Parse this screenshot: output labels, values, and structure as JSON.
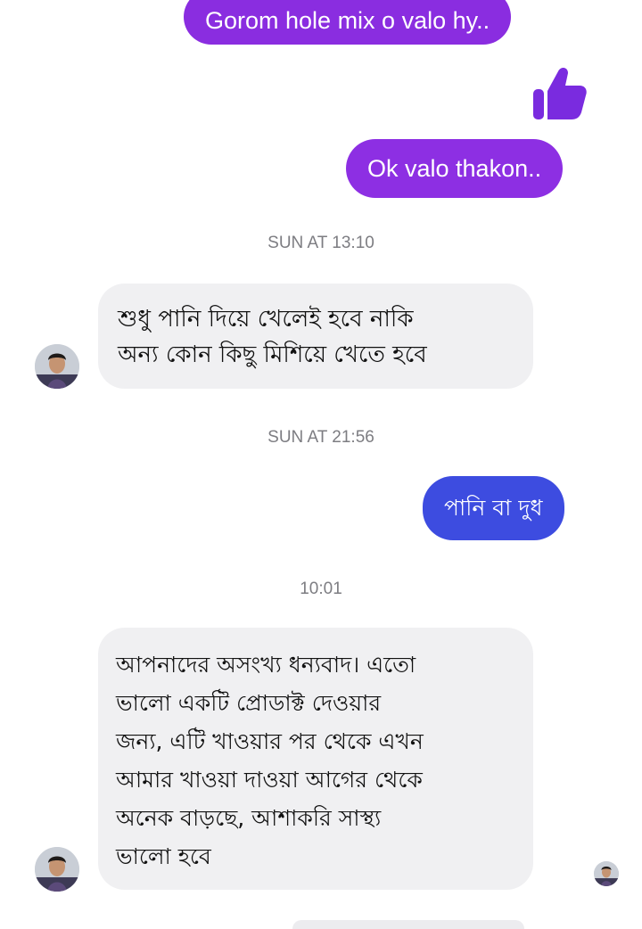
{
  "colors": {
    "outgoing_purple": "#8a2de0",
    "outgoing_purple_alt": "#8d2fe3",
    "outgoing_blue": "#3d4ce0",
    "incoming_gray": "#f0f0f2",
    "like_icon": "#7a2bdf",
    "timestamp": "#7d7d82"
  },
  "messages": {
    "m1": "Gorom hole mix o valo hy..",
    "m2_icon": "thumbs-up",
    "m3": "Ok valo thakon..",
    "ts1": "SUN AT 13:10",
    "m4": [
      "শুধু পানি দিয়ে খেলেই হবে নাকি",
      "অন্য কোন কিছু মিশিয়ে খেতে হবে"
    ],
    "ts2": "SUN AT 21:56",
    "m5": "পানি বা দুধ",
    "ts3": "10:01",
    "m6": [
      "আপনাদের অসংখ্য ধন্যবাদ। এতো",
      "ভালো একটি প্রোডাক্ট দেওয়ার",
      "জন্য, এটি খাওয়ার পর থেকে এখন",
      "আমার খাওয়া দাওয়া আগের থেকে",
      "অনেক বাড়ছে, আশাকরি সাস্থ্য",
      "ভালো হবে"
    ]
  }
}
